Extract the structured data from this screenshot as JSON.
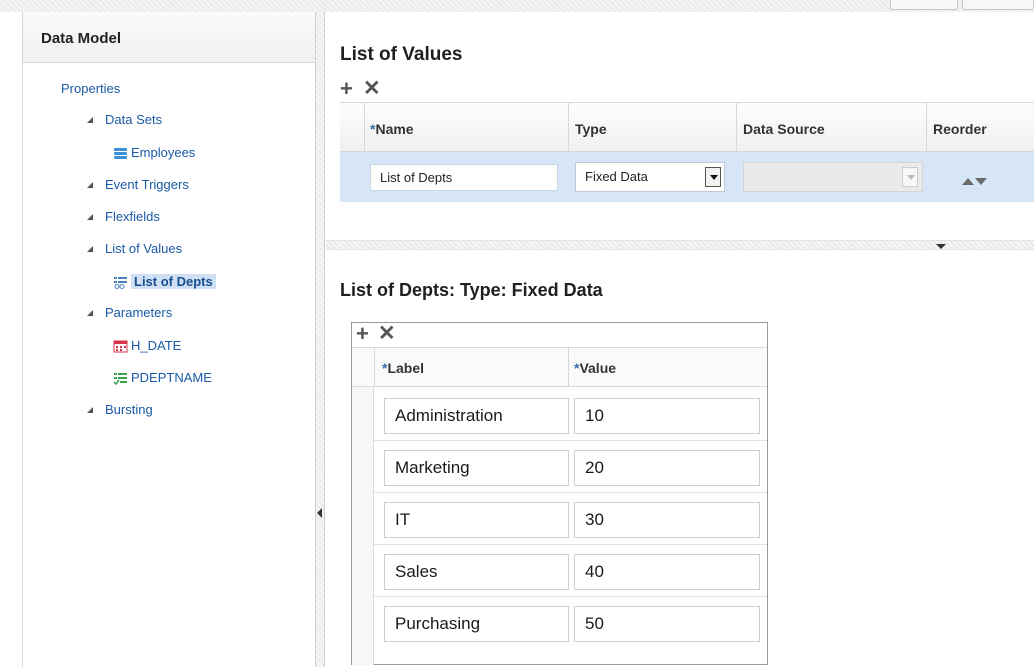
{
  "left_panel": {
    "title": "Data Model",
    "tree": {
      "properties": "Properties",
      "data_sets": "Data Sets",
      "employees": "Employees",
      "event_triggers": "Event Triggers",
      "flexfields": "Flexfields",
      "list_of_values": "List of Values",
      "list_of_depts": "List of Depts",
      "parameters": "Parameters",
      "h_date": "H_DATE",
      "pdeptname": "PDEPTNAME",
      "bursting": "Bursting"
    }
  },
  "lov_section": {
    "title": "List of Values",
    "columns": {
      "name": "Name",
      "type": "Type",
      "data_source": "Data Source",
      "reorder": "Reorder"
    },
    "required_marker": "*",
    "row": {
      "name": "List of Depts",
      "type": "Fixed Data",
      "data_source": ""
    }
  },
  "fixed_data_section": {
    "title": "List of Depts: Type: Fixed Data",
    "columns": {
      "label": "Label",
      "value": "Value"
    },
    "required_marker": "*",
    "rows": [
      {
        "label": "Administration",
        "value": "10"
      },
      {
        "label": "Marketing",
        "value": "20"
      },
      {
        "label": "IT",
        "value": "30"
      },
      {
        "label": "Sales",
        "value": "40"
      },
      {
        "label": "Purchasing",
        "value": "50"
      }
    ]
  },
  "icons": {
    "add": "plus-icon",
    "delete": "close-icon",
    "dataset": "database-icon",
    "lov": "list-icon",
    "date_param": "calendar-icon",
    "menu_param": "checklist-icon"
  },
  "colors": {
    "link": "#1a5aa6",
    "selected_row": "#d6e6f7",
    "tree_selected": "#cfe0f5",
    "dataset_icon": "#3a8fd9",
    "calendar_icon": "#d9354a",
    "checklist_icon": "#3aa34a"
  }
}
